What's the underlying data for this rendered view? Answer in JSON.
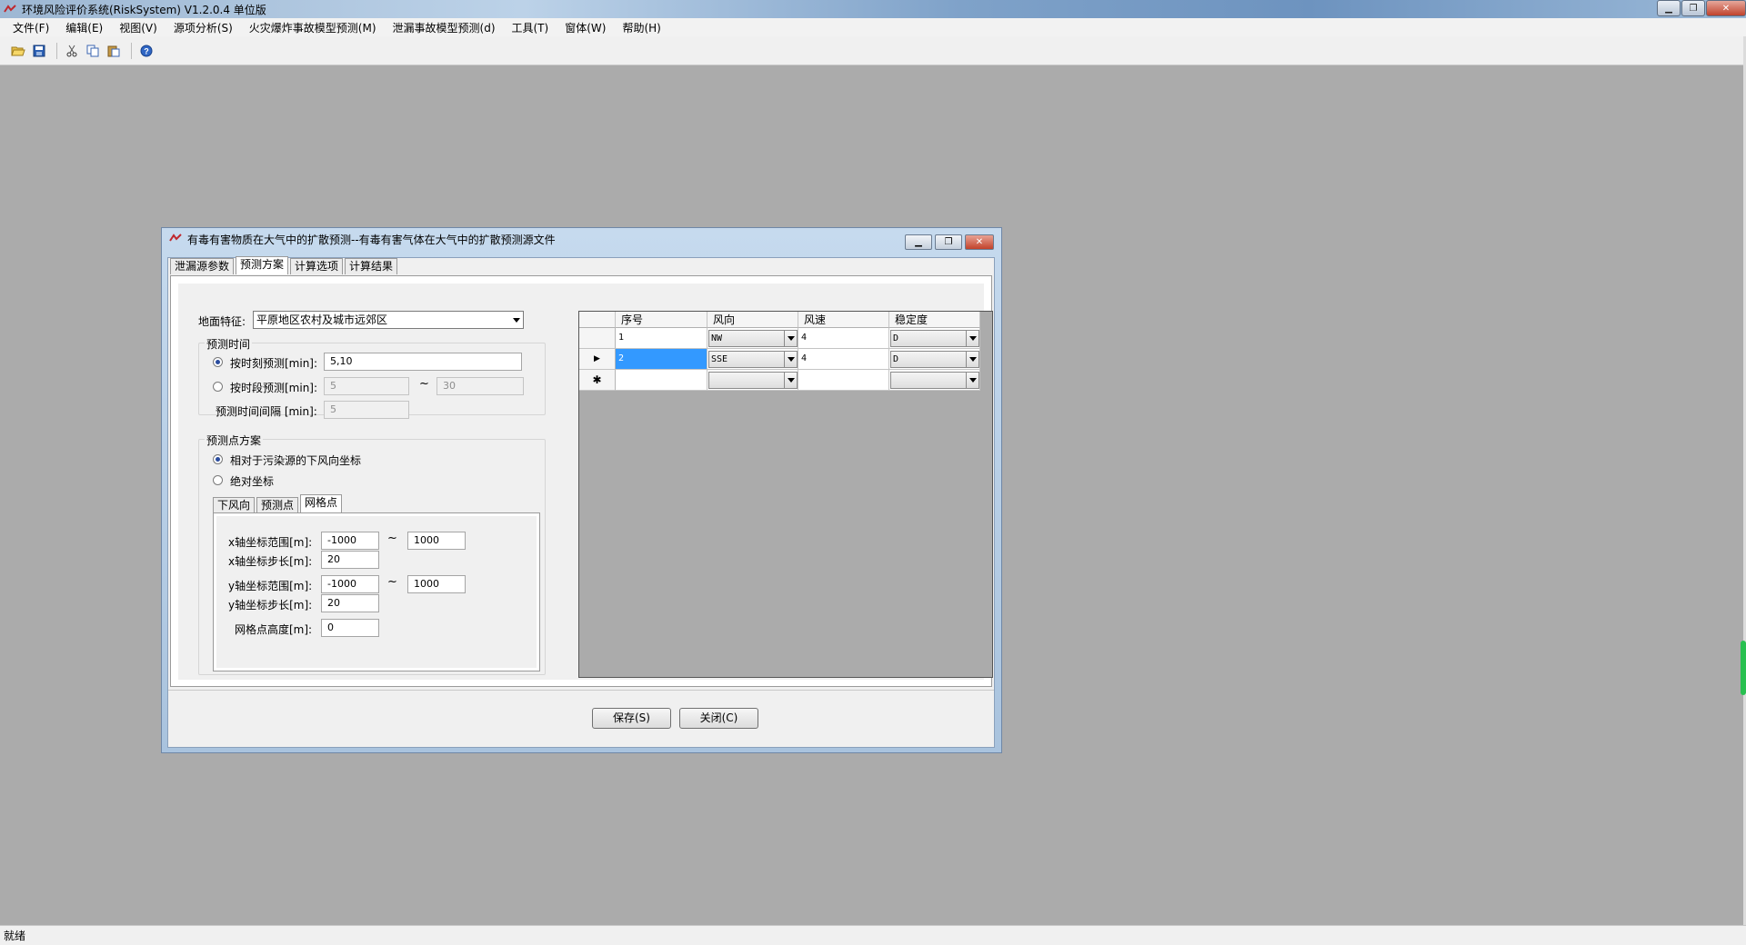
{
  "app": {
    "title": "环境风险评价系统(RiskSystem) V1.2.0.4 单位版"
  },
  "menu": [
    "文件(F)",
    "编辑(E)",
    "视图(V)",
    "源项分析(S)",
    "火灾爆炸事故模型预测(M)",
    "泄漏事故模型预测(d)",
    "工具(T)",
    "窗体(W)",
    "帮助(H)"
  ],
  "toolbar": {
    "icons": [
      "open-folder-icon",
      "save-icon",
      "cut-icon",
      "copy-icon",
      "paste-icon",
      "help-icon"
    ]
  },
  "status": {
    "text": "就绪"
  },
  "dialog": {
    "title": "有毒有害物质在大气中的扩散预测--有毒有害气体在大气中的扩散预测源文件",
    "tabs": [
      "泄漏源参数",
      "预测方案",
      "计算选项",
      "计算结果"
    ],
    "active_tab": 1,
    "ground": {
      "label": "地面特征:",
      "value": "平原地区农村及城市远郊区"
    },
    "time_group": {
      "title": "预测时间",
      "by_moment_label": "按时刻预测[min]:",
      "by_moment_value": "5,10",
      "by_period_label": "按时段预测[min]:",
      "period_from": "5",
      "period_to": "30",
      "interval_label": "预测时间间隔 [min]:",
      "interval_value": "5",
      "tilde": "~"
    },
    "point_group": {
      "title": "预测点方案",
      "relative_label": "相对于污染源的下风向坐标",
      "absolute_label": "绝对坐标",
      "subtabs": [
        "下风向",
        "预测点",
        "网格点"
      ],
      "active_subtab": 2,
      "x_range_label": "x轴坐标范围[m]:",
      "x_from": "-1000",
      "x_to": "1000",
      "x_step_label": "x轴坐标步长[m]:",
      "x_step": "20",
      "y_range_label": "y轴坐标范围[m]:",
      "y_from": "-1000",
      "y_to": "1000",
      "y_step_label": "y轴坐标步长[m]:",
      "y_step": "20",
      "height_label": "网格点高度[m]:",
      "height": "0",
      "tilde": "~"
    },
    "grid": {
      "columns": [
        "序号",
        "风向",
        "风速",
        "稳定度"
      ],
      "rows": [
        {
          "marker": "",
          "seq": "1",
          "dir": "NW",
          "speed": "4",
          "stability": "D"
        },
        {
          "marker": "▶",
          "seq": "2",
          "dir": "SSE",
          "speed": "4",
          "stability": "D"
        },
        {
          "marker": "✱",
          "seq": "",
          "dir": "",
          "speed": "",
          "stability": ""
        }
      ]
    },
    "buttons": {
      "save": "保存(S)",
      "close": "关闭(C)"
    }
  }
}
